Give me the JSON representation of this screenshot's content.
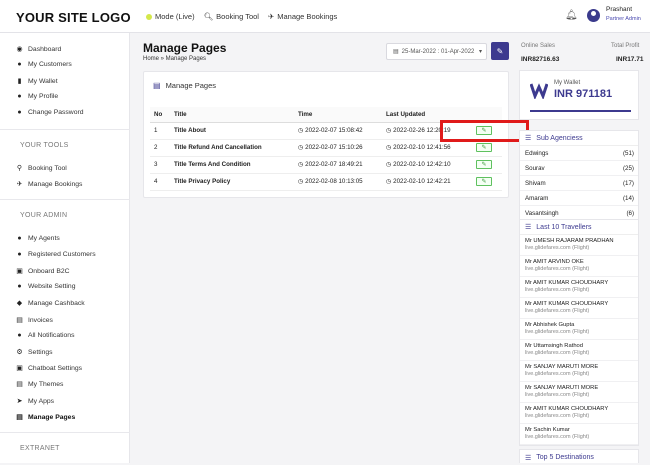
{
  "header": {
    "logo": "YOUR SITE LOGO",
    "nav": [
      {
        "label": "Mode (Live)",
        "icon": "live-dot"
      },
      {
        "label": "Booking Tool",
        "icon": "search-icon"
      },
      {
        "label": "Manage Bookings",
        "icon": "plane-icon"
      }
    ],
    "user": {
      "name": "Prashant",
      "role": "Partner Admin"
    }
  },
  "sidebar": {
    "items": [
      {
        "label": "Dashboard",
        "icon": "dashboard-icon"
      },
      {
        "label": "My Customers",
        "icon": "users-icon"
      },
      {
        "label": "My Wallet",
        "icon": "wallet-icon"
      },
      {
        "label": "My Profile",
        "icon": "profile-icon"
      },
      {
        "label": "Change Password",
        "icon": "lock-icon"
      }
    ],
    "tools_heading": "YOUR TOOLS",
    "tools": [
      {
        "label": "Booking Tool",
        "icon": "search-icon"
      },
      {
        "label": "Manage Bookings",
        "icon": "plane-icon"
      }
    ],
    "admin_heading": "YOUR ADMIN",
    "admin": [
      {
        "label": "My Agents",
        "icon": "agents-icon"
      },
      {
        "label": "Registered Customers",
        "icon": "customers-icon"
      },
      {
        "label": "Onboard B2C",
        "icon": "onboard-icon"
      },
      {
        "label": "Website Setting",
        "icon": "globe-icon"
      },
      {
        "label": "Manage Cashback",
        "icon": "tag-icon"
      },
      {
        "label": "Invoices",
        "icon": "invoice-icon"
      },
      {
        "label": "All Notifications",
        "icon": "bell-icon"
      },
      {
        "label": "Settings",
        "icon": "gear-icon"
      },
      {
        "label": "Chatboat Settings",
        "icon": "chat-icon"
      },
      {
        "label": "My Themes",
        "icon": "theme-icon"
      },
      {
        "label": "My Apps",
        "icon": "rocket-icon"
      },
      {
        "label": "Manage Pages",
        "icon": "pages-icon"
      }
    ],
    "extranet_heading": "EXTRANET"
  },
  "main": {
    "title": "Manage Pages",
    "breadcrumb": "Home » Manage Pages",
    "date_range": "25-Mar-2022 : 01-Apr-2022",
    "card_title": "Manage Pages",
    "columns": [
      "No",
      "Title",
      "Time",
      "Last Updated",
      ""
    ],
    "rows": [
      {
        "no": "1",
        "title": "Title About",
        "time": "2022-02-07 15:08:42",
        "updated": "2022-02-26 12:20:19"
      },
      {
        "no": "2",
        "title": "Title Refund And Cancellation",
        "time": "2022-02-07 15:10:26",
        "updated": "2022-02-10 12:41:56"
      },
      {
        "no": "3",
        "title": "Title Terms And Condition",
        "time": "2022-02-07 18:49:21",
        "updated": "2022-02-10 12:42:10"
      },
      {
        "no": "4",
        "title": "Title Privacy Policy",
        "time": "2022-02-08 10:13:05",
        "updated": "2022-02-10 12:42:21"
      }
    ]
  },
  "right": {
    "online_sales_label": "Online Sales",
    "online_sales_value": "INR82716.63",
    "total_profit_label": "Total Profit",
    "total_profit_value": "INR17.71",
    "wallet_label": "My Wallet",
    "wallet_value": "INR 971181",
    "sub_agencies_title": "Sub Agenciess",
    "sub_agencies": [
      {
        "name": "Edwings",
        "count": "(51)"
      },
      {
        "name": "Sourav",
        "count": "(25)"
      },
      {
        "name": "Shivam",
        "count": "(17)"
      },
      {
        "name": "Amaram",
        "count": "(14)"
      },
      {
        "name": "Vasantsingh",
        "count": "(6)"
      }
    ],
    "travellers_title": "Last 10 Travellers",
    "travellers": [
      {
        "name": "Mr UMESH RAJARAM PRADHAN",
        "sub": "live.glidefares.com (Flight)"
      },
      {
        "name": "Mr AMIT ARVIND OKE",
        "sub": "live.glidefares.com (Flight)"
      },
      {
        "name": "Mr AMIT KUMAR CHOUDHARY",
        "sub": "live.glidefares.com (Flight)"
      },
      {
        "name": "Mr AMIT KUMAR CHOUDHARY",
        "sub": "live.glidefares.com (Flight)"
      },
      {
        "name": "Mr Abhishek Gupta",
        "sub": "live.glidefares.com (Flight)"
      },
      {
        "name": "Mr Uttamsingh Rathod",
        "sub": "live.glidefares.com (Flight)"
      },
      {
        "name": "Mr SANJAY MARUTI MORE",
        "sub": "live.glidefares.com (Flight)"
      },
      {
        "name": "Mr SANJAY MARUTI MORE",
        "sub": "live.glidefares.com (Flight)"
      },
      {
        "name": "Mr AMIT KUMAR CHOUDHARY",
        "sub": "live.glidefares.com (Flight)"
      },
      {
        "name": "Mr Sachin Kumar",
        "sub": "live.glidefares.com (Flight)"
      }
    ],
    "destinations_title": "Top 5 Destinations"
  },
  "colors": {
    "accent": "#3d3a8f",
    "highlight": "#e01a1a",
    "edit_green": "#5fc15f"
  }
}
